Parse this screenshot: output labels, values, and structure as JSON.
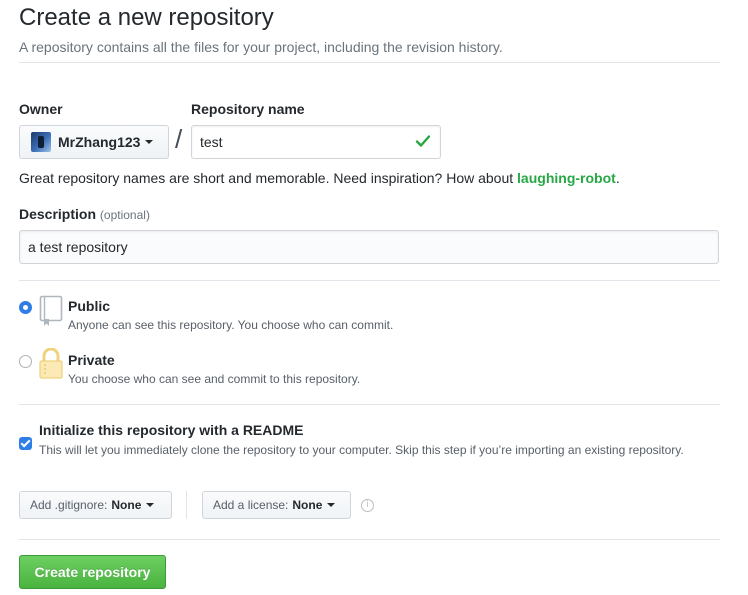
{
  "header": {
    "title": "Create a new repository",
    "subtitle": "A repository contains all the files for your project, including the revision history."
  },
  "owner": {
    "label": "Owner",
    "value": "MrZhang123"
  },
  "separator": "/",
  "repository_name": {
    "label": "Repository name",
    "value": "test",
    "valid_icon": "check-icon"
  },
  "hint": {
    "text": "Great repository names are short and memorable. Need inspiration? How about ",
    "suggestion": "laughing-robot",
    "end": "."
  },
  "description": {
    "label": "Description",
    "optional": "(optional)",
    "value": "a test repository"
  },
  "visibility": {
    "selected": "public",
    "public": {
      "title": "Public",
      "note": "Anyone can see this repository. You choose who can commit.",
      "icon": "repo-book-icon"
    },
    "private": {
      "title": "Private",
      "note": "You choose who can see and commit to this repository.",
      "icon": "lock-icon"
    }
  },
  "readme": {
    "checked": true,
    "label": "Initialize this repository with a README",
    "note": "This will let you immediately clone the repository to your computer. Skip this step if you’re importing an existing repository."
  },
  "gitignore": {
    "label": "Add .gitignore:",
    "value": "None"
  },
  "license": {
    "label": "Add a license:",
    "value": "None"
  },
  "info_icon": "i",
  "submit": {
    "label": "Create repository"
  },
  "colors": {
    "accent_blue": "#2f7ee8",
    "success_green": "#28a745",
    "button_green": "#4ab33e"
  }
}
